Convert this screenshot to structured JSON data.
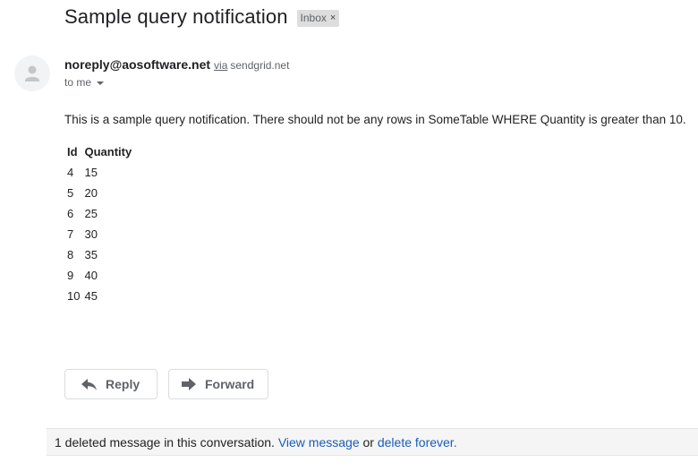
{
  "email": {
    "subject": "Sample query notification",
    "label": "Inbox",
    "label_remove": "×",
    "sender": {
      "address": "noreply@aosoftware.net",
      "via_text": "via",
      "via_domain": "sendgrid.net"
    },
    "recipient": "to me",
    "body_text": "This is a sample query notification. There should not be any rows in SomeTable WHERE Quantity is greater than 10.",
    "table": {
      "headers": [
        "Id",
        "Quantity"
      ],
      "rows": [
        [
          "4",
          "15"
        ],
        [
          "5",
          "20"
        ],
        [
          "6",
          "25"
        ],
        [
          "7",
          "30"
        ],
        [
          "8",
          "35"
        ],
        [
          "9",
          "40"
        ],
        [
          "10",
          "45"
        ]
      ]
    }
  },
  "actions": {
    "reply_label": "Reply",
    "forward_label": "Forward"
  },
  "deleted_notice": {
    "prefix": "1 deleted message in this conversation.",
    "view_link": "View message",
    "connector": "or",
    "delete_link": "delete forever",
    "suffix": "."
  },
  "icons": {
    "avatar": "person-avatar-icon",
    "reply": "reply-arrow-icon",
    "forward": "forward-arrow-icon",
    "caret": "caret-down-icon"
  },
  "colors": {
    "link": "#1a5cb8",
    "chip_bg": "#dddddd",
    "notice_bg": "#f5f5f5"
  }
}
